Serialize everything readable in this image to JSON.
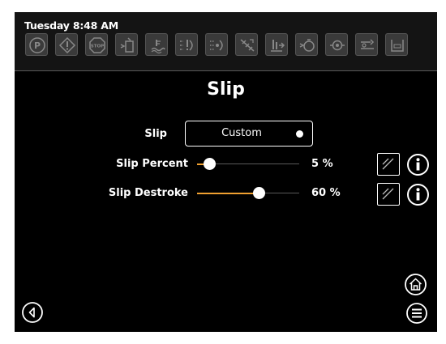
{
  "status": {
    "time": "Tuesday 8:48 AM"
  },
  "status_icons": [
    "park-icon",
    "warning-icon",
    "stop-icon",
    "fuel-icon",
    "coolant-icon",
    "service-icon",
    "lights-icon",
    "traction-icon",
    "ptosignal-icon",
    "oil-icon",
    "filter-icon",
    "transmission-icon",
    "wash-icon"
  ],
  "page": {
    "title": "Slip"
  },
  "slip": {
    "label": "Slip",
    "value": "Custom"
  },
  "slip_percent": {
    "label": "Slip Percent",
    "value_text": "5 %",
    "level": 0.05
  },
  "slip_destroke": {
    "label": "Slip Destroke",
    "value_text": "60 %",
    "level": 0.6
  },
  "colors": {
    "accent": "#f0a030",
    "background": "#000000",
    "text": "#ffffff"
  }
}
